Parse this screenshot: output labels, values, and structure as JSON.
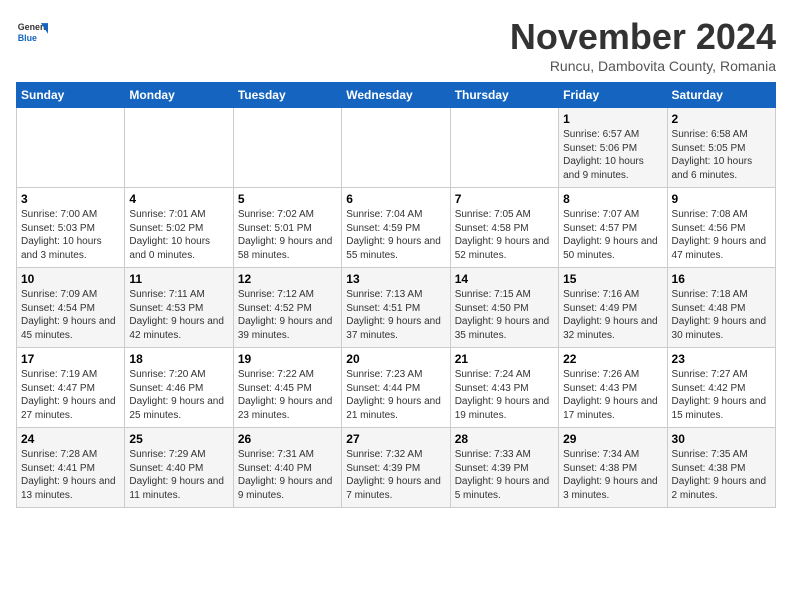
{
  "header": {
    "logo_general": "General",
    "logo_blue": "Blue",
    "month_title": "November 2024",
    "subtitle": "Runcu, Dambovita County, Romania"
  },
  "days_of_week": [
    "Sunday",
    "Monday",
    "Tuesday",
    "Wednesday",
    "Thursday",
    "Friday",
    "Saturday"
  ],
  "weeks": [
    [
      {
        "day": "",
        "info": ""
      },
      {
        "day": "",
        "info": ""
      },
      {
        "day": "",
        "info": ""
      },
      {
        "day": "",
        "info": ""
      },
      {
        "day": "",
        "info": ""
      },
      {
        "day": "1",
        "info": "Sunrise: 6:57 AM\nSunset: 5:06 PM\nDaylight: 10 hours and 9 minutes."
      },
      {
        "day": "2",
        "info": "Sunrise: 6:58 AM\nSunset: 5:05 PM\nDaylight: 10 hours and 6 minutes."
      }
    ],
    [
      {
        "day": "3",
        "info": "Sunrise: 7:00 AM\nSunset: 5:03 PM\nDaylight: 10 hours and 3 minutes."
      },
      {
        "day": "4",
        "info": "Sunrise: 7:01 AM\nSunset: 5:02 PM\nDaylight: 10 hours and 0 minutes."
      },
      {
        "day": "5",
        "info": "Sunrise: 7:02 AM\nSunset: 5:01 PM\nDaylight: 9 hours and 58 minutes."
      },
      {
        "day": "6",
        "info": "Sunrise: 7:04 AM\nSunset: 4:59 PM\nDaylight: 9 hours and 55 minutes."
      },
      {
        "day": "7",
        "info": "Sunrise: 7:05 AM\nSunset: 4:58 PM\nDaylight: 9 hours and 52 minutes."
      },
      {
        "day": "8",
        "info": "Sunrise: 7:07 AM\nSunset: 4:57 PM\nDaylight: 9 hours and 50 minutes."
      },
      {
        "day": "9",
        "info": "Sunrise: 7:08 AM\nSunset: 4:56 PM\nDaylight: 9 hours and 47 minutes."
      }
    ],
    [
      {
        "day": "10",
        "info": "Sunrise: 7:09 AM\nSunset: 4:54 PM\nDaylight: 9 hours and 45 minutes."
      },
      {
        "day": "11",
        "info": "Sunrise: 7:11 AM\nSunset: 4:53 PM\nDaylight: 9 hours and 42 minutes."
      },
      {
        "day": "12",
        "info": "Sunrise: 7:12 AM\nSunset: 4:52 PM\nDaylight: 9 hours and 39 minutes."
      },
      {
        "day": "13",
        "info": "Sunrise: 7:13 AM\nSunset: 4:51 PM\nDaylight: 9 hours and 37 minutes."
      },
      {
        "day": "14",
        "info": "Sunrise: 7:15 AM\nSunset: 4:50 PM\nDaylight: 9 hours and 35 minutes."
      },
      {
        "day": "15",
        "info": "Sunrise: 7:16 AM\nSunset: 4:49 PM\nDaylight: 9 hours and 32 minutes."
      },
      {
        "day": "16",
        "info": "Sunrise: 7:18 AM\nSunset: 4:48 PM\nDaylight: 9 hours and 30 minutes."
      }
    ],
    [
      {
        "day": "17",
        "info": "Sunrise: 7:19 AM\nSunset: 4:47 PM\nDaylight: 9 hours and 27 minutes."
      },
      {
        "day": "18",
        "info": "Sunrise: 7:20 AM\nSunset: 4:46 PM\nDaylight: 9 hours and 25 minutes."
      },
      {
        "day": "19",
        "info": "Sunrise: 7:22 AM\nSunset: 4:45 PM\nDaylight: 9 hours and 23 minutes."
      },
      {
        "day": "20",
        "info": "Sunrise: 7:23 AM\nSunset: 4:44 PM\nDaylight: 9 hours and 21 minutes."
      },
      {
        "day": "21",
        "info": "Sunrise: 7:24 AM\nSunset: 4:43 PM\nDaylight: 9 hours and 19 minutes."
      },
      {
        "day": "22",
        "info": "Sunrise: 7:26 AM\nSunset: 4:43 PM\nDaylight: 9 hours and 17 minutes."
      },
      {
        "day": "23",
        "info": "Sunrise: 7:27 AM\nSunset: 4:42 PM\nDaylight: 9 hours and 15 minutes."
      }
    ],
    [
      {
        "day": "24",
        "info": "Sunrise: 7:28 AM\nSunset: 4:41 PM\nDaylight: 9 hours and 13 minutes."
      },
      {
        "day": "25",
        "info": "Sunrise: 7:29 AM\nSunset: 4:40 PM\nDaylight: 9 hours and 11 minutes."
      },
      {
        "day": "26",
        "info": "Sunrise: 7:31 AM\nSunset: 4:40 PM\nDaylight: 9 hours and 9 minutes."
      },
      {
        "day": "27",
        "info": "Sunrise: 7:32 AM\nSunset: 4:39 PM\nDaylight: 9 hours and 7 minutes."
      },
      {
        "day": "28",
        "info": "Sunrise: 7:33 AM\nSunset: 4:39 PM\nDaylight: 9 hours and 5 minutes."
      },
      {
        "day": "29",
        "info": "Sunrise: 7:34 AM\nSunset: 4:38 PM\nDaylight: 9 hours and 3 minutes."
      },
      {
        "day": "30",
        "info": "Sunrise: 7:35 AM\nSunset: 4:38 PM\nDaylight: 9 hours and 2 minutes."
      }
    ]
  ]
}
